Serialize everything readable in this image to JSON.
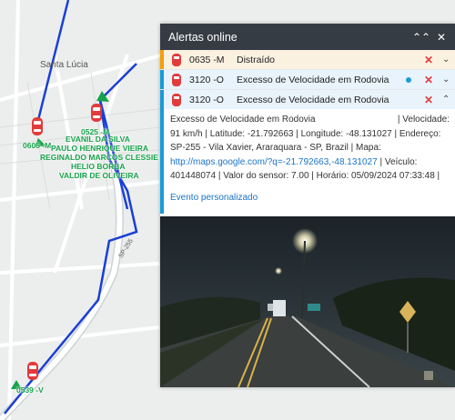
{
  "map": {
    "place_label": "Santa Lúcia",
    "road_label": "SP-255",
    "vehicles": [
      {
        "id": "v0525",
        "label": "0525 -M"
      },
      {
        "id": "v0605",
        "label": "0605 -M"
      },
      {
        "id": "v0539",
        "label": "0539 -V"
      }
    ],
    "drivers": [
      "EVANIL DA SILVA",
      "PAULO HENRIQUE VIEIRA",
      "REGINALDO MARCOS CLESSIE",
      "HELIO BORBA",
      "VALDIR DE OLIVEIRA"
    ]
  },
  "panel": {
    "title": "Alertas online",
    "alerts": [
      {
        "code": "0635 -M",
        "description": "Distraído",
        "color": "#f59e0b"
      },
      {
        "code": "3120 -O",
        "description": "Excesso de Velocidade em Rodovia",
        "color": "#1a9bd7"
      },
      {
        "code": "3120 -O",
        "description": "Excesso de Velocidade em Rodovia",
        "color": "#1a9bd7"
      }
    ],
    "detail": {
      "line1": "Excesso de Velocidade em Rodovia",
      "line1b": "| Velocidade:",
      "line2": "91 km/h | Latitude: -21.792663 | Longitude: -48.131027 | Endereço:",
      "line3": "SP-255 - Vila Xavier, Araraquara - SP, Brazil | Mapa:",
      "map_link": "http://maps.google.com/?q=-21.792663,-48.131027",
      "line4_rest": " | Veículo:",
      "line5": "401448074  | Valor do sensor: 7.00 | Horário: 05/09/2024 07:33:48 |",
      "custom_event": "Evento personalizado"
    }
  },
  "colors": {
    "header": "#353c43",
    "accent_blue": "#1a9bd7",
    "accent_orange": "#f59e0b",
    "route": "#1a3fd6",
    "label_green": "#16a34a"
  }
}
